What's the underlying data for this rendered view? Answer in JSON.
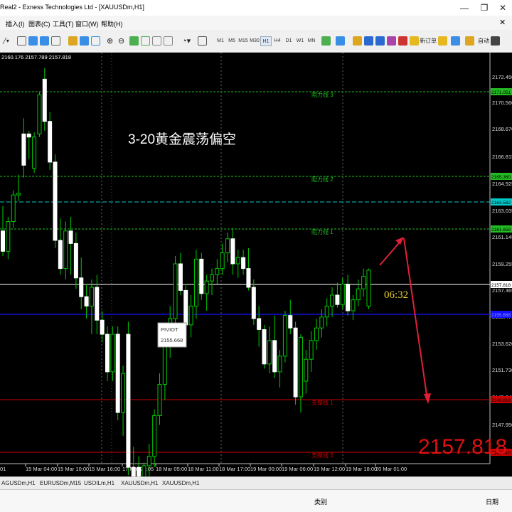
{
  "window": {
    "title": "Real2 - Exness Technologies Ltd - [XAUUSDm,H1]"
  },
  "menu": [
    "插入(I)",
    "图表(C)",
    "工具(T)",
    "窗口(W)",
    "帮助(H)"
  ],
  "toolbar": {
    "timeframes": [
      "M1",
      "M5",
      "M15",
      "M30",
      "H1",
      "H4",
      "D1",
      "W1",
      "MN"
    ],
    "new_order": "新订单",
    "autotrade": "自动"
  },
  "chart": {
    "ohlc_text": "2160.176 2157.789 2157.818",
    "annotation": "3-20黄金震荡偏空",
    "countdown": "06:32",
    "current_price": "2157.818",
    "pivot_box": {
      "line1": "PIVIOT",
      "line2": "2155.668"
    },
    "x_labels": [
      "01",
      "15 Mar 04:00",
      "15 Mar 10:00",
      "15 Mar 16:00",
      "17 Mar 23:05",
      "18 Mar 05:00",
      "18 Mar 11:00",
      "18 Mar 17:00",
      "19 Mar 00:00",
      "19 Mar 06:00",
      "19 Mar 12:00",
      "19 Mar 18:00",
      "20 Mar 01:00"
    ],
    "y_labels": [
      "2172.450",
      "2170.560",
      "2168.670",
      "2166.815",
      "2164.925",
      "2163.035",
      "2161.145",
      "2159.255",
      "2157.365",
      "2155.475",
      "2153.620",
      "2151.730",
      "2149.840",
      "2147.950"
    ],
    "levels": [
      {
        "name": "阻力线 3",
        "tag": "2171.051",
        "color": "#22bb22"
      },
      {
        "name": "阻力线 2",
        "tag": "2165.360",
        "color": "#22bb22"
      },
      {
        "name": "阻力线 1",
        "tag": "2161.659",
        "color": "#22bb22"
      },
      {
        "name": "",
        "tag": "2163.582",
        "color": "#00cccc"
      },
      {
        "name": "",
        "tag": "2157.818",
        "color": "#ffffff"
      },
      {
        "name": "",
        "tag": "2155.668",
        "color": "#1010ff"
      },
      {
        "name": "支撑线 1",
        "tag": "2148.818",
        "color": "#cc0000"
      },
      {
        "name": "支撑线 2",
        "tag": "2146.010",
        "color": "#cc0000"
      }
    ]
  },
  "symbol_tabs": [
    "AGUSDm,H1",
    "EURUSDm,M15",
    "USOILm,H1",
    "XAUUSDm,H1",
    "XAUUSDm,H1"
  ],
  "bottom_panel": {
    "category": "类别",
    "date": "日期"
  }
}
